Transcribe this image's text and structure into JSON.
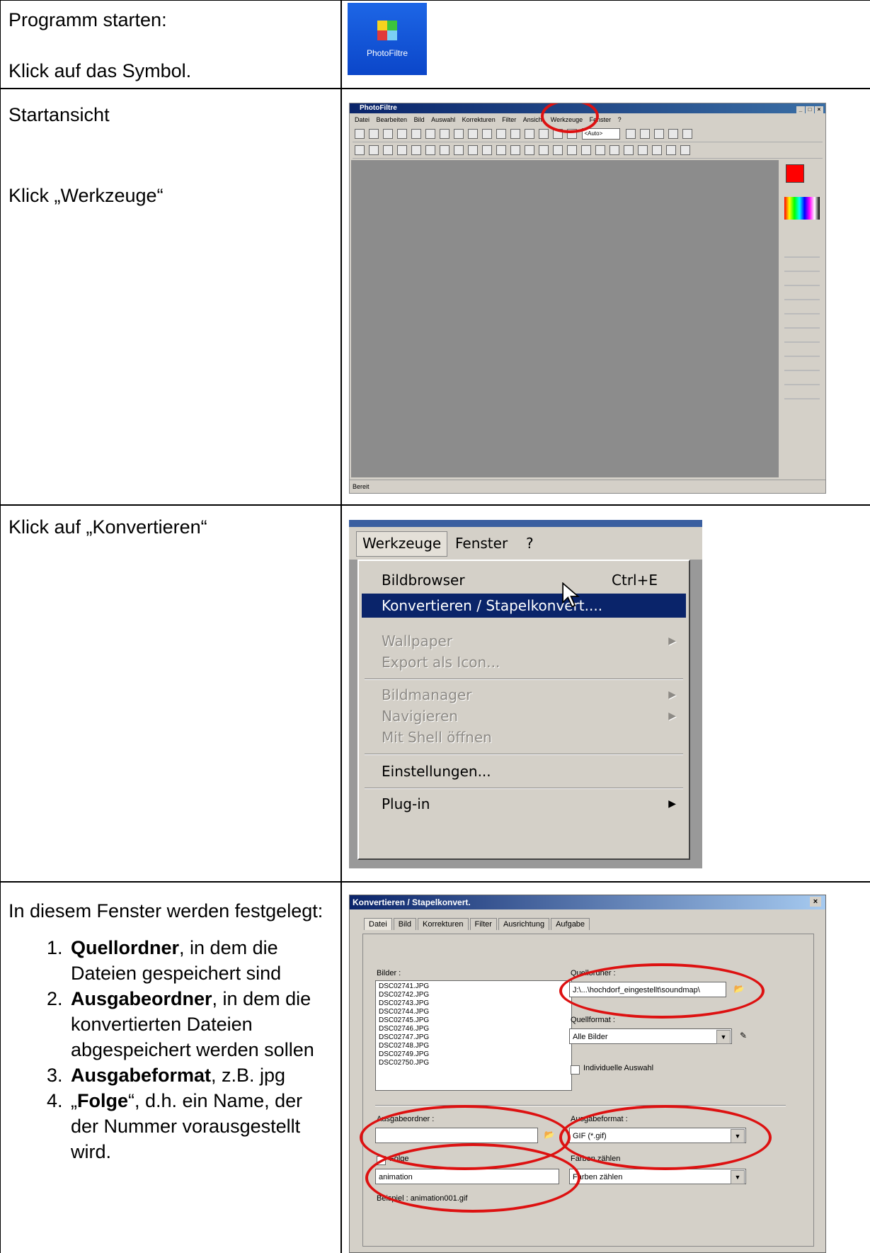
{
  "rows": [
    {
      "lines": [
        "Programm starten:",
        "Klick auf das Symbol."
      ]
    },
    {
      "lines": [
        "Startansicht",
        "Klick „Werkzeuge“"
      ]
    },
    {
      "lines": [
        "Klick auf „Konvertieren“"
      ]
    },
    {
      "intro": "In diesem Fenster werden festgelegt:",
      "items": [
        {
          "bold": "Quellordner",
          "rest": ", in dem die Dateien gespeichert sind"
        },
        {
          "bold": "Ausgabeordner",
          "rest": ", in dem die konvertierten Dateien abgespeichert werden sollen"
        },
        {
          "bold": "Ausgabeformat",
          "rest": ", z.B. jpg"
        },
        {
          "pre": "„",
          "bold": "Folge",
          "rest": "“, d.h. ein Name, der der Nummer vorausgestellt wird."
        }
      ]
    }
  ],
  "icon": {
    "caption": "PhotoFiltre",
    "name": "photofiltre-icon"
  },
  "screen1": {
    "title": "PhotoFiltre",
    "menu": [
      "Datei",
      "Bearbeiten",
      "Bild",
      "Auswahl",
      "Korrekturen",
      "Filter",
      "Ansicht",
      "Werkzeuge",
      "Fenster",
      "?"
    ],
    "zoom": "<Auto>",
    "status": "Bereit"
  },
  "screen2": {
    "menubar": [
      "Werkzeuge",
      "Fenster",
      "?"
    ],
    "items": [
      {
        "label": "Bildbrowser",
        "shortcut": "Ctrl+E"
      },
      {
        "label": "Konvertieren / Stapelkonvert....",
        "highlighted": true
      },
      {
        "label": "Wallpaper",
        "disabled": true,
        "submenu": true
      },
      {
        "label": "Export als Icon...",
        "disabled": true
      },
      {
        "label": "Bildmanager",
        "disabled": true,
        "submenu": true
      },
      {
        "label": "Navigieren",
        "disabled": true,
        "submenu": true
      },
      {
        "label": "Mit Shell öffnen",
        "disabled": true
      },
      {
        "label": "Einstellungen..."
      },
      {
        "label": "Plug-in",
        "submenu": true
      }
    ]
  },
  "screen3": {
    "title": "Konvertieren / Stapelkonvert.",
    "tabs": [
      "Datei",
      "Bild",
      "Korrekturen",
      "Filter",
      "Ausrichtung",
      "Aufgabe"
    ],
    "bilder_label": "Bilder :",
    "files": [
      "DSC02741.JPG",
      "DSC02742.JPG",
      "DSC02743.JPG",
      "DSC02744.JPG",
      "DSC02745.JPG",
      "DSC02746.JPG",
      "DSC02747.JPG",
      "DSC02748.JPG",
      "DSC02749.JPG",
      "DSC02750.JPG"
    ],
    "quellordner_label": "Quellordner :",
    "quellordner_value": "J:\\...\\hochdorf_eingestellt\\soundmap\\",
    "quellformat_label": "Quellformat :",
    "quellformat_value": "Alle Bilder",
    "individuelle": "Individuelle Auswahl",
    "ausgabeordner_label": "Ausgabeordner :",
    "ausgabeordner_value": "",
    "ausgabeformat_label": "Ausgabeformat :",
    "ausgabeformat_value": "GIF (*.gif)",
    "folge_label": "Folge",
    "folge_value": "animation",
    "farben_label": "Farben zählen",
    "farben_value": "Farben zählen",
    "beispiel": "Beispiel : animation001.gif"
  }
}
